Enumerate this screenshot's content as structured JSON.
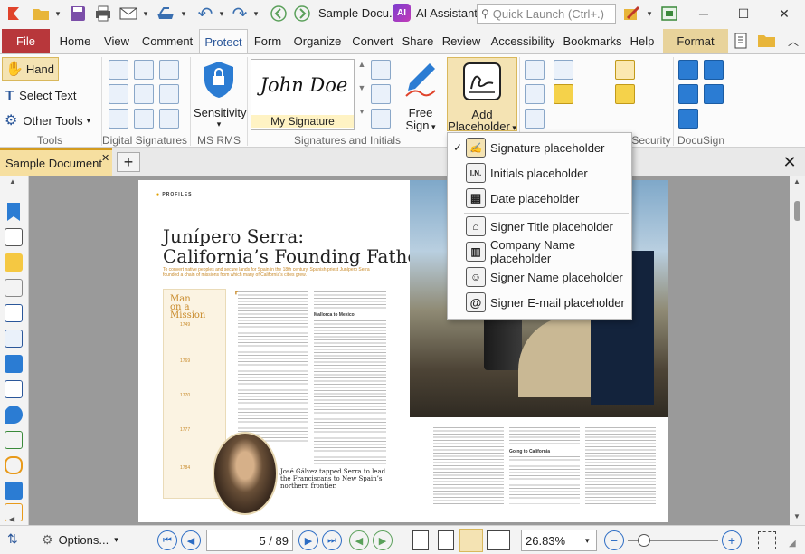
{
  "titlebar": {
    "document_title": "Sample Docu...",
    "ai_label": "AI Assistant",
    "ai_icon_text": "AI",
    "search_placeholder": "Quick Launch (Ctrl+.)",
    "icons": [
      "foxit-app-icon",
      "open-folder-icon",
      "save-icon",
      "print-icon",
      "email-icon",
      "scanner-icon",
      "undo-icon",
      "redo-icon",
      "back-icon",
      "forward-icon",
      "skin-icon",
      "fullscreen-icon"
    ]
  },
  "window_controls": {
    "minimize": "─",
    "maximize": "☐",
    "close": "✕"
  },
  "ribbon_tabs": [
    {
      "label": "File"
    },
    {
      "label": "Home"
    },
    {
      "label": "View"
    },
    {
      "label": "Comment"
    },
    {
      "label": "Protect",
      "active": true
    },
    {
      "label": "Form"
    },
    {
      "label": "Organize"
    },
    {
      "label": "Convert"
    },
    {
      "label": "Share"
    },
    {
      "label": "Review"
    },
    {
      "label": "Accessibility"
    },
    {
      "label": "Bookmarks"
    },
    {
      "label": "Help"
    },
    {
      "label": "Format",
      "contextual": true
    }
  ],
  "ribbon": {
    "tools": {
      "hand": "Hand",
      "select_text": "Select Text",
      "other_tools": "Other Tools",
      "group": "Tools"
    },
    "digital_signatures": {
      "group": "Digital Signatures"
    },
    "ms_rms": {
      "sensitivity": "Sensitivity",
      "group": "MS RMS"
    },
    "signatures": {
      "sample_name": "John Doe",
      "my_signature": "My Signature",
      "free_sign_1": "Free",
      "free_sign_2": "Sign",
      "add_placeholder_1": "Add",
      "add_placeholder_2": "Placeholder",
      "group": "Signatures and Initials"
    },
    "security": {
      "group": "Security"
    },
    "docusign": {
      "group": "DocuSign"
    }
  },
  "placeholder_menu": {
    "items": [
      {
        "label": "Signature placeholder",
        "icon": "signature-icon",
        "checked": true
      },
      {
        "label": "Initials placeholder",
        "icon": "initials-icon"
      },
      {
        "label": "Date placeholder",
        "icon": "calendar-icon"
      },
      {
        "label": "Signer Title placeholder",
        "icon": "signer-title-icon"
      },
      {
        "label": "Company Name placeholder",
        "icon": "company-building-icon"
      },
      {
        "label": "Signer Name placeholder",
        "icon": "person-icon"
      },
      {
        "label": "Signer E-mail placeholder",
        "icon": "at-sign-icon"
      }
    ],
    "initials_glyph": "I.N.",
    "email_glyph": "@"
  },
  "document_tabs": [
    {
      "label": "Sample Document",
      "active": true
    }
  ],
  "document_page": {
    "kicker": "PROFILES",
    "headline_1": "Junípero Serra:",
    "headline_2": "California’s Founding Father",
    "deck": "To convert native peoples and secure lands for Spain in the 18th century, Spanish priest Junípero Serra founded a chain of missions from which many of California’s cities grew.",
    "sidebar_title_1": "Man",
    "sidebar_title_2": "on a",
    "sidebar_title_3": "Mission",
    "timeline_years": [
      "1749",
      "1769",
      "1770",
      "1777",
      "1784"
    ],
    "subhead": "Mallorca to Mexico",
    "caption": "José Gálvez tapped Serra to lead the Franciscans to New Spain’s northern frontier.",
    "subhead_right": "Going to California",
    "dropcap": "T"
  },
  "statusbar": {
    "options": "Options...",
    "page_display": "5 / 89",
    "zoom": "26.83%"
  },
  "colors": {
    "file_tab": "#b8373b",
    "accent_blue": "#2b579a",
    "doc_tab": "#f6dfa0",
    "format_tab": "#e8d39b",
    "highlight": "#f4e3b3"
  }
}
